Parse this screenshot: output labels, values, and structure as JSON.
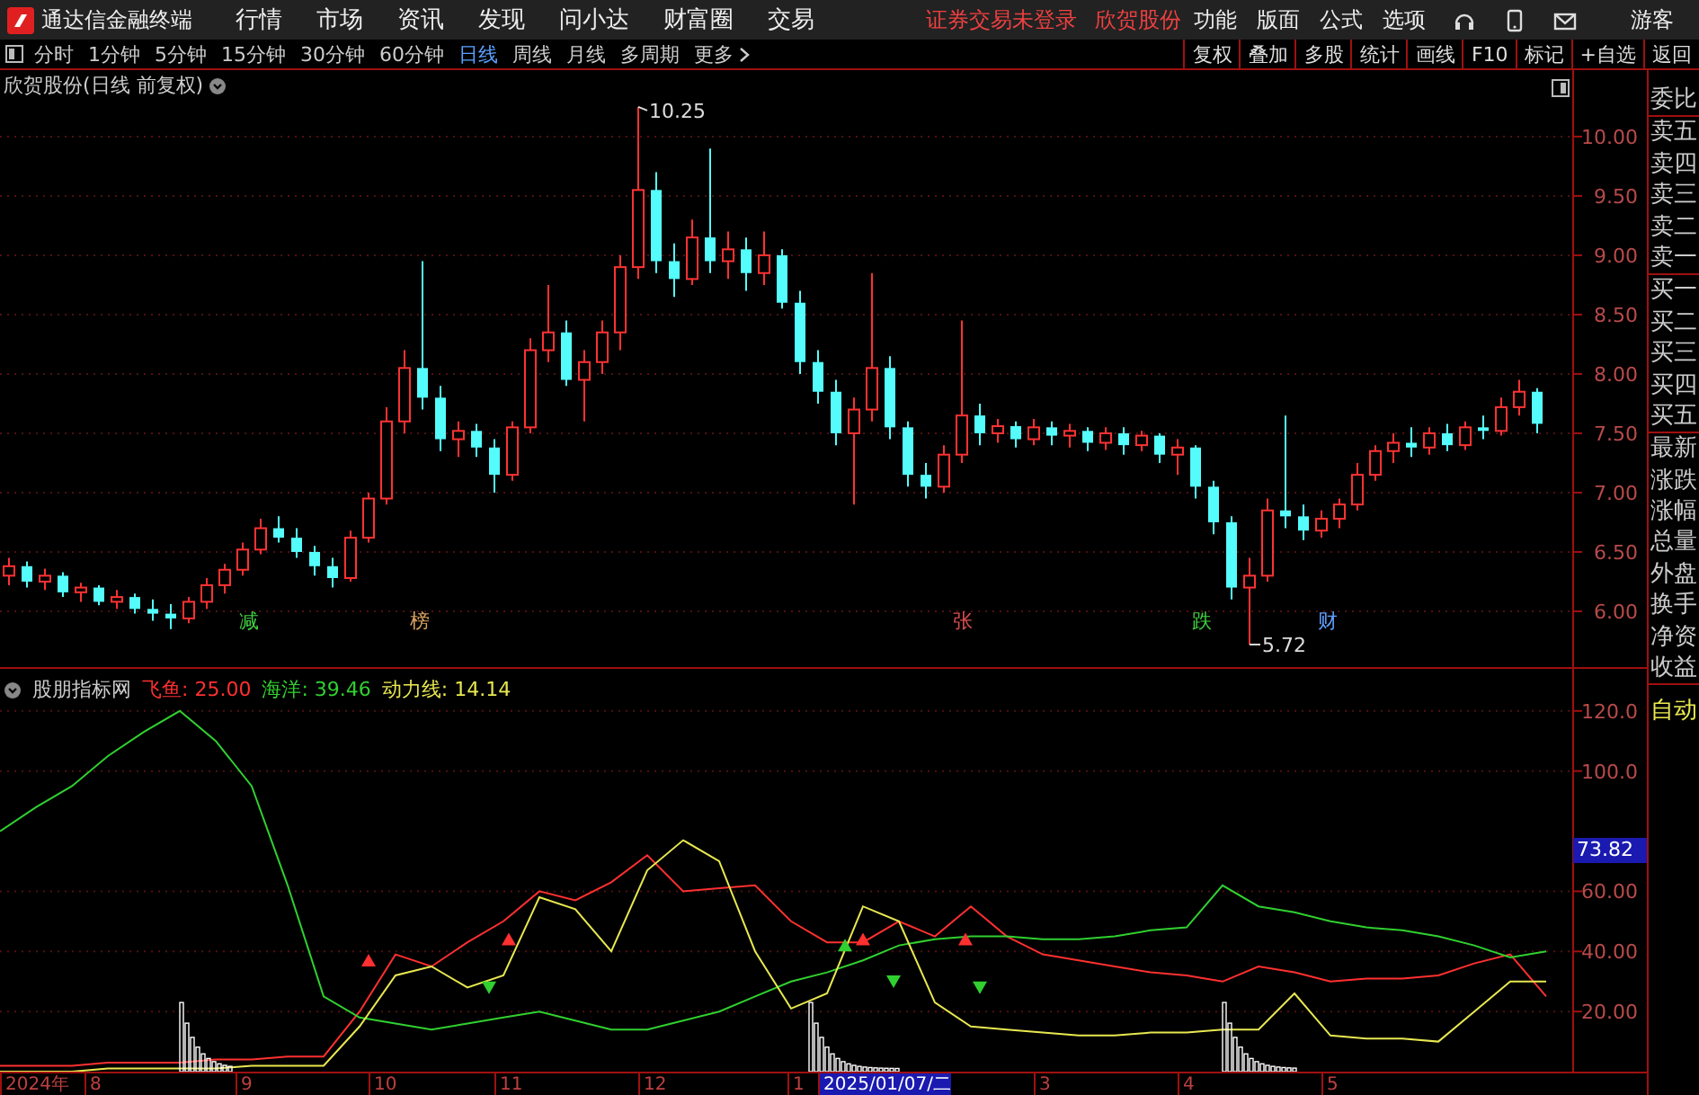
{
  "menubar": {
    "app_title": "通达信金融终端",
    "menus": [
      "行情",
      "市场",
      "资讯",
      "发现",
      "问小达",
      "财富圈",
      "交易"
    ],
    "notice": "证券交易未登录",
    "stock": "欣贺股份",
    "tools": [
      "功能",
      "版面",
      "公式",
      "选项"
    ],
    "user": "游客"
  },
  "toolbar": {
    "periods": [
      {
        "label": "分时",
        "selected": false
      },
      {
        "label": "1分钟",
        "selected": false
      },
      {
        "label": "5分钟",
        "selected": false
      },
      {
        "label": "15分钟",
        "selected": false
      },
      {
        "label": "30分钟",
        "selected": false
      },
      {
        "label": "60分钟",
        "selected": false
      },
      {
        "label": "日线",
        "selected": true
      },
      {
        "label": "周线",
        "selected": false
      },
      {
        "label": "月线",
        "selected": false
      },
      {
        "label": "多周期",
        "selected": false
      }
    ],
    "more": "更多",
    "buttons": [
      "复权",
      "叠加",
      "多股",
      "统计",
      "画线",
      "F10",
      "标记",
      "+自选",
      "返回"
    ]
  },
  "price_chart": {
    "title": "欣贺股份(日线 前复权)",
    "high_label": "10.25",
    "low_label": "5.72",
    "markers": [
      {
        "text": "减",
        "color": "#40d040"
      },
      {
        "text": "榜",
        "color": "#d8a060"
      },
      {
        "text": "张",
        "color": "#e05050"
      },
      {
        "text": "跌",
        "color": "#40d040"
      },
      {
        "text": "财",
        "color": "#60a0ff"
      }
    ],
    "chart_data": {
      "type": "candlestick",
      "ylim": [
        5.53,
        10.56
      ],
      "grid": true,
      "yticks": [
        {
          "value": 10,
          "label": "10.00"
        },
        {
          "value": 9.5,
          "label": "9.50"
        },
        {
          "value": 9,
          "label": "9.00"
        },
        {
          "value": 8.5,
          "label": "8.50"
        },
        {
          "value": 8,
          "label": "8.00"
        },
        {
          "value": 7.5,
          "label": "7.50"
        },
        {
          "value": 7,
          "label": "7.00"
        },
        {
          "value": 6.5,
          "label": "6.50"
        },
        {
          "value": 6,
          "label": "6.00"
        }
      ],
      "ohlc": [
        [
          6.3,
          6.45,
          6.22,
          6.38
        ],
        [
          6.38,
          6.42,
          6.2,
          6.25
        ],
        [
          6.25,
          6.36,
          6.18,
          6.3
        ],
        [
          6.3,
          6.33,
          6.12,
          6.16
        ],
        [
          6.16,
          6.24,
          6.08,
          6.2
        ],
        [
          6.2,
          6.22,
          6.05,
          6.08
        ],
        [
          6.08,
          6.18,
          6.02,
          6.12
        ],
        [
          6.12,
          6.15,
          5.98,
          6.02
        ],
        [
          6.02,
          6.1,
          5.92,
          5.98
        ],
        [
          5.98,
          6.06,
          5.85,
          5.94
        ],
        [
          5.94,
          6.12,
          5.9,
          6.08
        ],
        [
          6.08,
          6.28,
          6.02,
          6.22
        ],
        [
          6.22,
          6.4,
          6.15,
          6.35
        ],
        [
          6.35,
          6.58,
          6.3,
          6.52
        ],
        [
          6.52,
          6.78,
          6.48,
          6.7
        ],
        [
          6.7,
          6.8,
          6.58,
          6.62
        ],
        [
          6.62,
          6.7,
          6.45,
          6.5
        ],
        [
          6.5,
          6.55,
          6.3,
          6.38
        ],
        [
          6.38,
          6.45,
          6.2,
          6.28
        ],
        [
          6.28,
          6.68,
          6.25,
          6.62
        ],
        [
          6.62,
          7.0,
          6.58,
          6.95
        ],
        [
          6.95,
          7.72,
          6.9,
          7.6
        ],
        [
          7.6,
          8.2,
          7.5,
          8.05
        ],
        [
          8.05,
          8.95,
          7.7,
          7.8
        ],
        [
          7.8,
          7.9,
          7.35,
          7.45
        ],
        [
          7.45,
          7.6,
          7.3,
          7.52
        ],
        [
          7.52,
          7.58,
          7.3,
          7.38
        ],
        [
          7.38,
          7.45,
          7.0,
          7.15
        ],
        [
          7.15,
          7.6,
          7.1,
          7.55
        ],
        [
          7.55,
          8.3,
          7.5,
          8.2
        ],
        [
          8.2,
          8.75,
          8.1,
          8.35
        ],
        [
          8.35,
          8.45,
          7.9,
          7.95
        ],
        [
          7.95,
          8.2,
          7.6,
          8.1
        ],
        [
          8.1,
          8.45,
          8.0,
          8.35
        ],
        [
          8.35,
          9.0,
          8.2,
          8.9
        ],
        [
          8.9,
          10.25,
          8.8,
          9.55
        ],
        [
          9.55,
          9.7,
          8.85,
          8.95
        ],
        [
          8.95,
          9.1,
          8.65,
          8.8
        ],
        [
          8.8,
          9.3,
          8.75,
          9.15
        ],
        [
          9.15,
          9.9,
          8.85,
          8.95
        ],
        [
          8.95,
          9.2,
          8.8,
          9.05
        ],
        [
          9.05,
          9.15,
          8.7,
          8.85
        ],
        [
          8.85,
          9.2,
          8.75,
          9.0
        ],
        [
          9.0,
          9.05,
          8.55,
          8.6
        ],
        [
          8.6,
          8.7,
          8.0,
          8.1
        ],
        [
          8.1,
          8.2,
          7.75,
          7.85
        ],
        [
          7.85,
          7.95,
          7.4,
          7.5
        ],
        [
          7.5,
          7.8,
          6.9,
          7.7
        ],
        [
          7.7,
          8.85,
          7.6,
          8.05
        ],
        [
          8.05,
          8.15,
          7.45,
          7.55
        ],
        [
          7.55,
          7.6,
          7.05,
          7.15
        ],
        [
          7.15,
          7.25,
          6.95,
          7.05
        ],
        [
          7.05,
          7.4,
          7.0,
          7.32
        ],
        [
          7.32,
          8.45,
          7.25,
          7.65
        ],
        [
          7.65,
          7.75,
          7.4,
          7.5
        ],
        [
          7.5,
          7.62,
          7.42,
          7.56
        ],
        [
          7.56,
          7.6,
          7.38,
          7.45
        ],
        [
          7.45,
          7.62,
          7.4,
          7.55
        ],
        [
          7.55,
          7.6,
          7.4,
          7.48
        ],
        [
          7.48,
          7.58,
          7.38,
          7.52
        ],
        [
          7.52,
          7.55,
          7.35,
          7.42
        ],
        [
          7.42,
          7.55,
          7.36,
          7.5
        ],
        [
          7.5,
          7.55,
          7.32,
          7.4
        ],
        [
          7.4,
          7.52,
          7.35,
          7.48
        ],
        [
          7.48,
          7.5,
          7.25,
          7.32
        ],
        [
          7.32,
          7.45,
          7.15,
          7.38
        ],
        [
          7.38,
          7.4,
          6.95,
          7.05
        ],
        [
          7.05,
          7.1,
          6.65,
          6.75
        ],
        [
          6.75,
          6.8,
          6.1,
          6.2
        ],
        [
          6.2,
          6.45,
          5.72,
          6.3
        ],
        [
          6.3,
          6.95,
          6.25,
          6.85
        ],
        [
          6.85,
          7.65,
          6.7,
          6.8
        ],
        [
          6.8,
          6.9,
          6.6,
          6.68
        ],
        [
          6.68,
          6.85,
          6.62,
          6.78
        ],
        [
          6.78,
          6.95,
          6.7,
          6.9
        ],
        [
          6.9,
          7.25,
          6.85,
          7.15
        ],
        [
          7.15,
          7.4,
          7.1,
          7.35
        ],
        [
          7.35,
          7.5,
          7.25,
          7.42
        ],
        [
          7.42,
          7.55,
          7.3,
          7.38
        ],
        [
          7.38,
          7.55,
          7.32,
          7.5
        ],
        [
          7.5,
          7.58,
          7.35,
          7.4
        ],
        [
          7.4,
          7.6,
          7.36,
          7.55
        ],
        [
          7.55,
          7.65,
          7.45,
          7.52
        ],
        [
          7.52,
          7.8,
          7.48,
          7.72
        ],
        [
          7.72,
          7.95,
          7.65,
          7.85
        ],
        [
          7.85,
          7.88,
          7.5,
          7.58
        ]
      ]
    }
  },
  "indicator": {
    "name": "股朋指标网",
    "legend": [
      {
        "sep": ":",
        "value": "25.00"
      },
      {
        "sep": ":",
        "value": "39.46"
      },
      {
        "sep": ":",
        "value": "14.14"
      }
    ],
    "current_value": "73.82",
    "chart_data": {
      "type": "line",
      "ylim": [
        0,
        134
      ],
      "grid": true,
      "yticks": [
        {
          "value": 120,
          "label": "120.0"
        },
        {
          "value": 100,
          "label": "100.0"
        },
        {
          "value": 60,
          "label": "60.00"
        },
        {
          "value": 40,
          "label": "40.00"
        },
        {
          "value": 20,
          "label": "20.00"
        }
      ],
      "series": [
        {
          "name": "飞鱼",
          "color": "#ff3030",
          "values": [
            2,
            2,
            2,
            3,
            3,
            3,
            4,
            4,
            5,
            5,
            20,
            39,
            35,
            43,
            50,
            60,
            57,
            63,
            72,
            60,
            61,
            62,
            50,
            43,
            43,
            50,
            45,
            55,
            45,
            39,
            37,
            35,
            33,
            32,
            30,
            35,
            33,
            30,
            31,
            31,
            32,
            36,
            39,
            25
          ]
        },
        {
          "name": "海洋",
          "color": "#30d030",
          "values": [
            80,
            88,
            95,
            105,
            113,
            120,
            110,
            95,
            62,
            25,
            18,
            16,
            14,
            16,
            18,
            20,
            17,
            14,
            14,
            17,
            20,
            25,
            30,
            33,
            37,
            42,
            44,
            45,
            45,
            44,
            44,
            45,
            47,
            48,
            62,
            55,
            53,
            50,
            48,
            47,
            45,
            42,
            38,
            40
          ]
        },
        {
          "name": "动力线",
          "color": "#e8e850",
          "values": [
            0,
            0,
            0,
            1,
            1,
            1,
            1,
            2,
            2,
            2,
            15,
            32,
            35,
            28,
            32,
            58,
            54,
            40,
            67,
            77,
            70,
            40,
            21,
            26,
            55,
            50,
            23,
            15,
            14,
            13,
            12,
            12,
            13,
            13,
            14,
            14,
            26,
            12,
            11,
            11,
            10,
            20,
            30,
            30
          ]
        }
      ]
    }
  },
  "date_axis": [
    {
      "text": "2024年",
      "kind": "tick"
    },
    {
      "text": "8",
      "kind": "tick"
    },
    {
      "text": "9",
      "kind": "tick"
    },
    {
      "text": "10",
      "kind": "tick"
    },
    {
      "text": "11",
      "kind": "tick"
    },
    {
      "text": "12",
      "kind": "tick"
    },
    {
      "text": "1",
      "kind": "tick"
    },
    {
      "text": "2025/01/07/二",
      "kind": "cursor"
    },
    {
      "text": "3",
      "kind": "tick"
    },
    {
      "text": "4",
      "kind": "tick"
    },
    {
      "text": "5",
      "kind": "tick"
    }
  ],
  "side_panel": [
    {
      "text": "委比",
      "kind": "field"
    },
    {
      "text": "卖五",
      "kind": "field"
    },
    {
      "text": "卖四",
      "kind": "field"
    },
    {
      "text": "卖三",
      "kind": "field"
    },
    {
      "text": "卖二",
      "kind": "field"
    },
    {
      "text": "卖一",
      "kind": "field"
    },
    {
      "text": "买一",
      "kind": "field"
    },
    {
      "text": "买二",
      "kind": "field"
    },
    {
      "text": "买三",
      "kind": "field"
    },
    {
      "text": "买四",
      "kind": "field"
    },
    {
      "text": "买五",
      "kind": "field"
    },
    {
      "text": "最新",
      "kind": "field"
    },
    {
      "text": "涨跌",
      "kind": "field"
    },
    {
      "text": "涨幅",
      "kind": "field"
    },
    {
      "text": "总量",
      "kind": "field"
    },
    {
      "text": "外盘",
      "kind": "field"
    },
    {
      "text": "换手",
      "kind": "field"
    },
    {
      "text": "净资",
      "kind": "field"
    },
    {
      "text": "收益",
      "kind": "field"
    },
    {
      "text": "自动",
      "kind": "button"
    }
  ]
}
